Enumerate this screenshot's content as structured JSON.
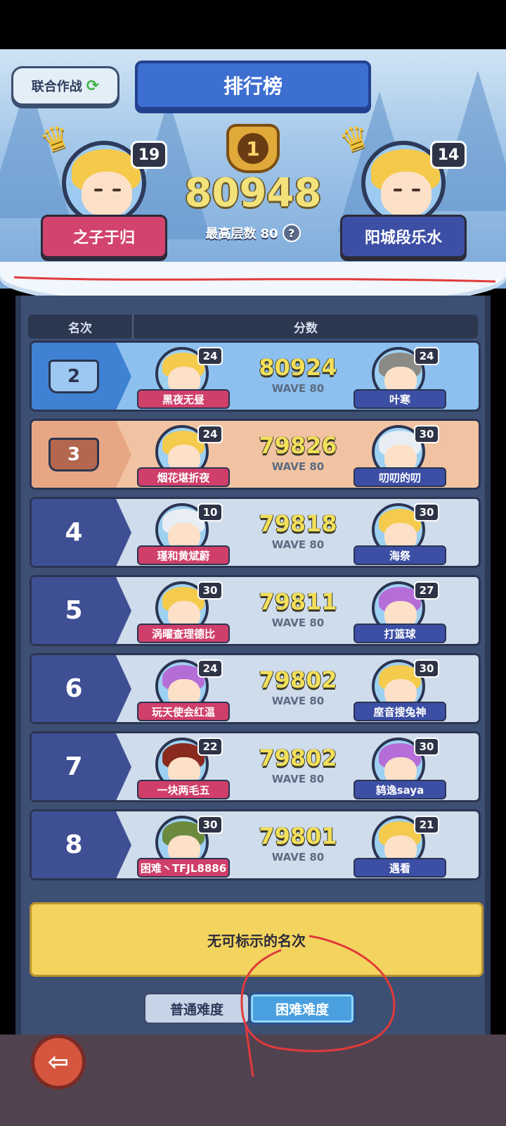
{
  "header": {
    "coop_label": "联合作战",
    "title": "排行榜",
    "top_score": "80948",
    "max_floor_label": "最高层数 80",
    "left_player": {
      "name": "之子于归",
      "level": "19"
    },
    "right_player": {
      "name": "阳城段乐水",
      "level": "14"
    },
    "rank1_label": "1"
  },
  "columns": {
    "rank": "名次",
    "score": "分数"
  },
  "wave_prefix": "WAVE 80",
  "rows": [
    {
      "rank": "2",
      "score": "80924",
      "wave": "WAVE 80",
      "left": {
        "name": "黑夜无昼",
        "level": "24"
      },
      "right": {
        "name": "叶寒",
        "level": "24"
      }
    },
    {
      "rank": "3",
      "score": "79826",
      "wave": "WAVE 80",
      "left": {
        "name": "烟花堪折夜",
        "level": "24"
      },
      "right": {
        "name": "叨叨的叨",
        "level": "30"
      }
    },
    {
      "rank": "4",
      "score": "79818",
      "wave": "WAVE 80",
      "left": {
        "name": "瑾和黄斌蔚",
        "level": "10"
      },
      "right": {
        "name": "海祭",
        "level": "30"
      }
    },
    {
      "rank": "5",
      "score": "79811",
      "wave": "WAVE 80",
      "left": {
        "name": "涡曜查理德比",
        "level": "30"
      },
      "right": {
        "name": "打篮球",
        "level": "27"
      }
    },
    {
      "rank": "6",
      "score": "79802",
      "wave": "WAVE 80",
      "left": {
        "name": "玩天使会红温",
        "level": "24"
      },
      "right": {
        "name": "庢音搜兔神",
        "level": "30"
      }
    },
    {
      "rank": "7",
      "score": "79802",
      "wave": "WAVE 80",
      "left": {
        "name": "一块两毛五",
        "level": "22"
      },
      "right": {
        "name": "鸫逸saya",
        "level": "30"
      }
    },
    {
      "rank": "8",
      "score": "79801",
      "wave": "WAVE 80",
      "left": {
        "name": "困难丶TFJL8886",
        "level": "30"
      },
      "right": {
        "name": "遇看",
        "level": "21"
      }
    }
  ],
  "empty_rank_text": "无可标示的名次",
  "tabs": {
    "normal": "普通难度",
    "hard": "困难难度"
  },
  "colors": {
    "accent": "#3d6fd1",
    "annotation": "#e23a3a",
    "hard_tab": "#4aa0df"
  },
  "icons": {
    "coop": "refresh-icon",
    "help": "question-icon",
    "back": "back-arrow-icon",
    "rank1": "shield-badge-icon",
    "crown": "crown-icon"
  }
}
